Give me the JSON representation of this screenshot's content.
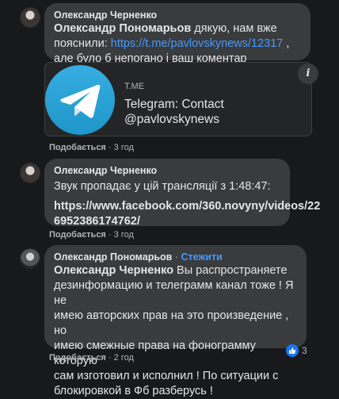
{
  "comments": [
    {
      "author": "Олександр Черненко",
      "mention": "Олександр Пономарьов",
      "text_before_link": " дякую, нам вже пояснили: ",
      "link": "https://t.me/pavlovskynews/12317",
      "text_after_link": " , але було б непогано і ваш коментар",
      "like_label": "Подобається",
      "time": "3 год",
      "preview": {
        "domain": "T.ME",
        "title_line1": "Telegram: Contact",
        "title_line2": "@pavlovskynews",
        "info_icon": "i"
      }
    },
    {
      "author": "Олександр Черненко",
      "text": "Звук пропадає у цій трансляції з 1:48:47:",
      "link_line1": "https://www.facebook.com/360.novyny/videos/22",
      "link_line2": "6952386174762/",
      "like_label": "Подобається",
      "time": "3 год"
    },
    {
      "author": "Олександр Пономарьов",
      "follow_label": "Стежити",
      "mention": "Олександр Черненко",
      "line1": " Вы распространяете",
      "line2": "дезинформацию и телеграмм канал тоже ! Я не",
      "line3": "имею авторских прав на это произведение , но",
      "line4": "имею смежные права на фонограмму которую",
      "line5": "сам изготовил и исполнил ! По ситуации с",
      "line6": "блокировкой в Фб разберусь !",
      "like_label": "Подобається",
      "time": "2 год",
      "reaction_count": "3"
    }
  ],
  "separator": "·",
  "colors": {
    "background": "#18191a",
    "bubble": "#3a3b3c",
    "link": "#4599ff",
    "like": "#1877f2"
  }
}
